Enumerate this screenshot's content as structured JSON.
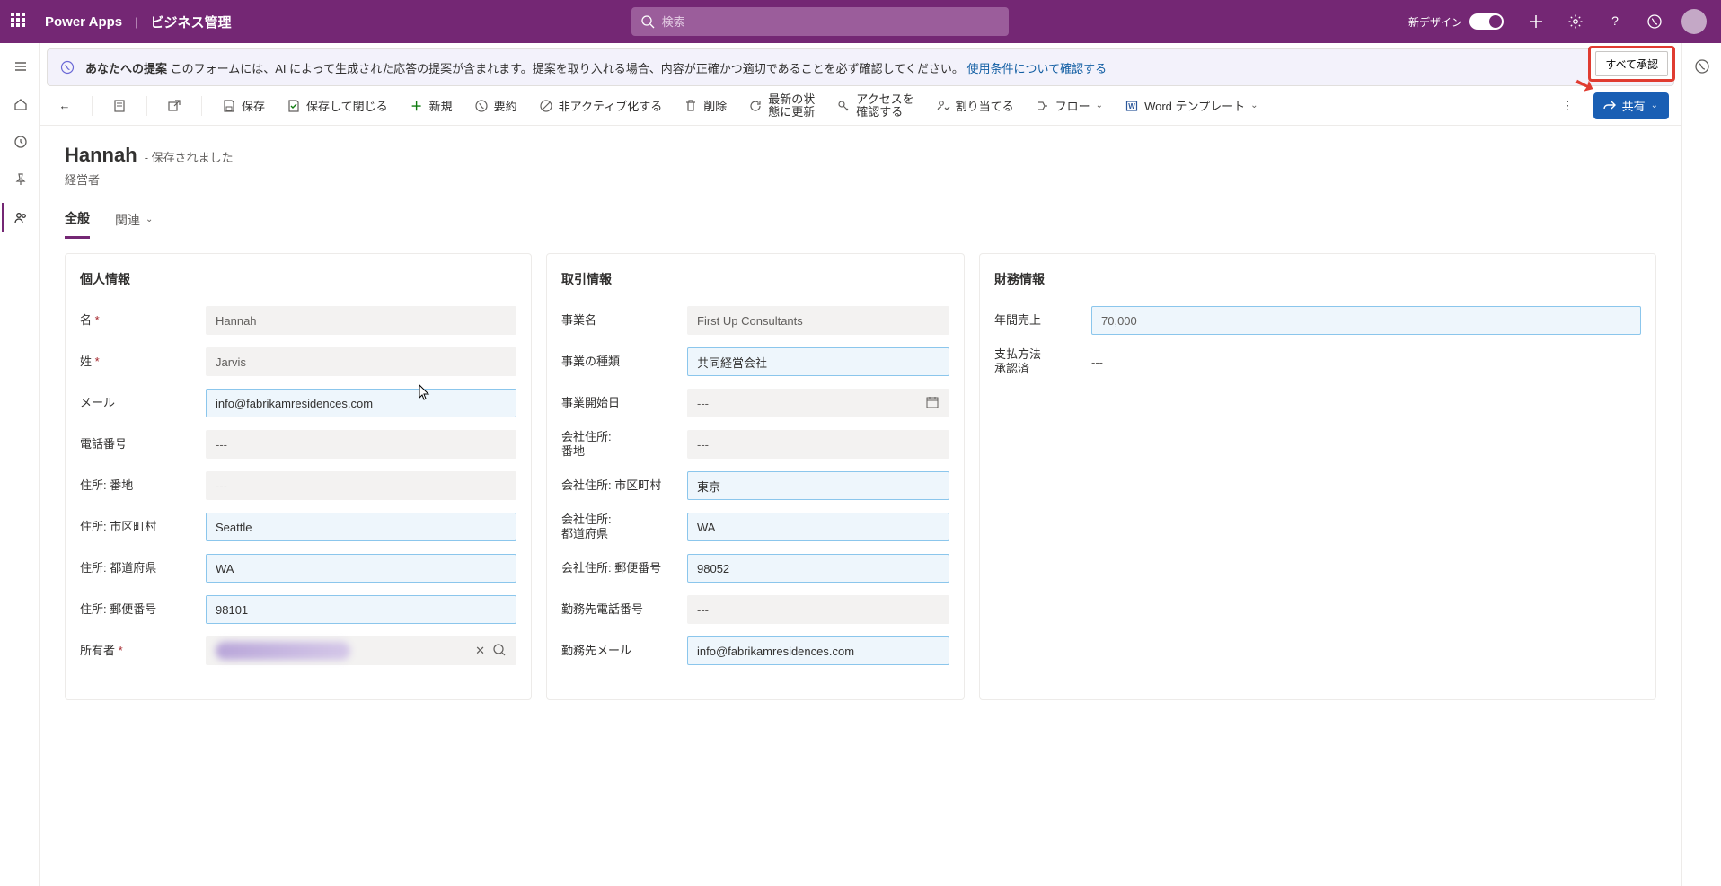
{
  "suite": {
    "brand": "Power Apps",
    "env": "ビジネス管理",
    "search_placeholder": "検索",
    "new_design_label": "新デザイン"
  },
  "suggestion": {
    "lead": "あなたへの提案",
    "body": "このフォームには、AI によって生成された応答の提案が含まれます。提案を取り入れる場合、内容が正確かつ適切であることを必ず確認してください。",
    "terms_link": "使用条件について確認する",
    "accept_all": "すべて承認"
  },
  "commands": {
    "save": "保存",
    "save_close": "保存して閉じる",
    "new_cmd": "新規",
    "summary": "要約",
    "deactivate": "非アクティブ化する",
    "delete": "削除",
    "refresh_l1": "最新の状",
    "refresh_l2": "態に更新",
    "access_l1": "アクセスを",
    "access_l2": "確認する",
    "assign": "割り当てる",
    "flow": "フロー",
    "word_template": "Word テンプレート",
    "share": "共有"
  },
  "record": {
    "name": "Hannah",
    "status_suffix": "- 保存されました",
    "subtitle": "経営者"
  },
  "tabs": {
    "general": "全般",
    "related": "関連"
  },
  "sec1": {
    "title": "個人情報",
    "first_name_label": "名",
    "first_name_value": "Hannah",
    "last_name_label": "姓",
    "last_name_value": "Jarvis",
    "email_label": "メール",
    "email_value": "info@fabrikamresidences.com",
    "phone_label": "電話番号",
    "phone_value": "---",
    "street_label": "住所: 番地",
    "street_value": "---",
    "city_label": "住所: 市区町村",
    "city_value": "Seattle",
    "state_label": "住所: 都道府県",
    "state_value": "WA",
    "zip_label": "住所: 郵便番号",
    "zip_value": "98101",
    "owner_label": "所有者"
  },
  "sec2": {
    "title": "取引情報",
    "biz_name_label": "事業名",
    "biz_name_value": "First Up Consultants",
    "biz_type_label": "事業の種類",
    "biz_type_value": "共同経営会社",
    "biz_start_label": "事業開始日",
    "biz_start_value": "---",
    "co_street_l1": "会社住所:",
    "co_street_l2": "番地",
    "co_street_value": "---",
    "co_city_label": "会社住所: 市区町村",
    "co_city_value": "東京",
    "co_state_l1": "会社住所:",
    "co_state_l2": "都道府県",
    "co_state_value": "WA",
    "co_zip_label": "会社住所: 郵便番号",
    "co_zip_value": "98052",
    "work_phone_label": "勤務先電話番号",
    "work_phone_value": "---",
    "work_email_label": "勤務先メール",
    "work_email_value": "info@fabrikamresidences.com"
  },
  "sec3": {
    "title": "財務情報",
    "annual_label": "年間売上",
    "annual_value": "70,000",
    "pay_l1": "支払方法",
    "pay_l2": "承認済",
    "pay_value": "---"
  }
}
